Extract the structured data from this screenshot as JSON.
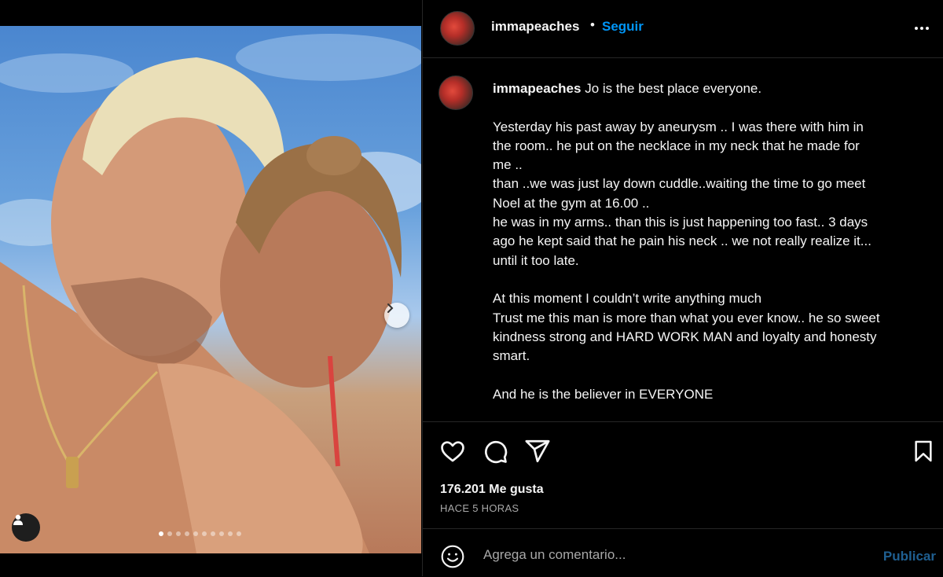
{
  "post": {
    "username": "immapeaches",
    "separator": "•",
    "follow_label": "Seguir",
    "more_icon": "more-horizontal-icon",
    "caption": {
      "username": "immapeaches",
      "lines": [
        "Jo is the best place everyone.",
        "",
        "Yesterday his past away by aneurysm .. I was there with him in",
        "the room.. he put on the necklace in my neck that he made for",
        "me ..",
        "than ..we was just lay down cuddle..waiting the time to go meet",
        "Noel at the gym at 16.00 ..",
        "he was in my arms.. than this is just happening too fast.. 3 days",
        "ago he kept said that he pain his neck .. we not really realize it...",
        "until it too late.",
        "",
        "At this moment I couldn’t write anything much",
        "Trust me this man is more than what you ever know.. he so sweet",
        "kindness strong and HARD WORK MAN and loyalty and honesty",
        "smart.",
        "",
        "And he is the believer in EVERYONE"
      ]
    },
    "likes_text": "176.201 Me gusta",
    "time_text": "HACE 5 HORAS",
    "comment": {
      "placeholder": "Agrega un comentario...",
      "publish_label": "Publicar"
    },
    "carousel": {
      "total_slides": 10,
      "active_index": 0
    }
  },
  "colors": {
    "background": "#000000",
    "accent_blue": "#0095f6",
    "publish_disabled": "#1f5f91",
    "muted_text": "#a8a8a8",
    "divider": "#262626"
  }
}
